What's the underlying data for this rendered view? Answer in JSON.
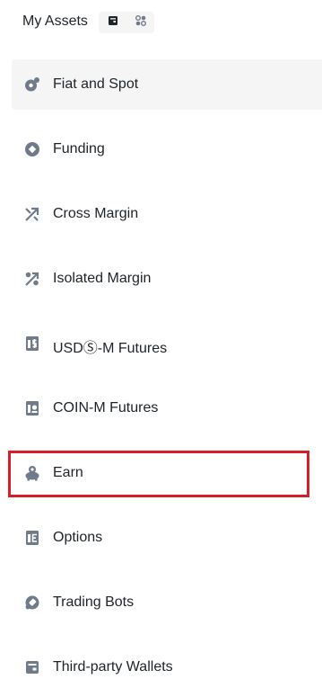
{
  "header": {
    "title": "My Assets",
    "toggle": [
      {
        "icon": "wallet-icon",
        "selected": true
      },
      {
        "icon": "grid-dots-icon",
        "selected": false
      }
    ]
  },
  "nav": {
    "items": [
      {
        "label": "Fiat and Spot",
        "icon": "fiat-spot-icon",
        "active": true
      },
      {
        "label": "Funding",
        "icon": "funding-icon",
        "active": false
      },
      {
        "label": "Cross Margin",
        "icon": "cross-margin-icon",
        "active": false
      },
      {
        "label": "Isolated Margin",
        "icon": "isolated-margin-icon",
        "active": false
      },
      {
        "label": "USDⓈ-M Futures",
        "icon": "usds-futures-icon",
        "active": false
      },
      {
        "label": "COIN-M Futures",
        "icon": "coin-futures-icon",
        "active": false
      },
      {
        "label": "Earn",
        "icon": "earn-icon",
        "active": false,
        "highlighted": true
      },
      {
        "label": "Options",
        "icon": "options-icon",
        "active": false
      },
      {
        "label": "Trading Bots",
        "icon": "trading-bots-icon",
        "active": false
      },
      {
        "label": "Third-party Wallets",
        "icon": "third-party-wallets-icon",
        "active": false
      }
    ]
  },
  "colors": {
    "text": "#1e2329",
    "icon": "#707a8a",
    "active_bg": "#f5f5f5",
    "highlight": "#d91e2a"
  }
}
